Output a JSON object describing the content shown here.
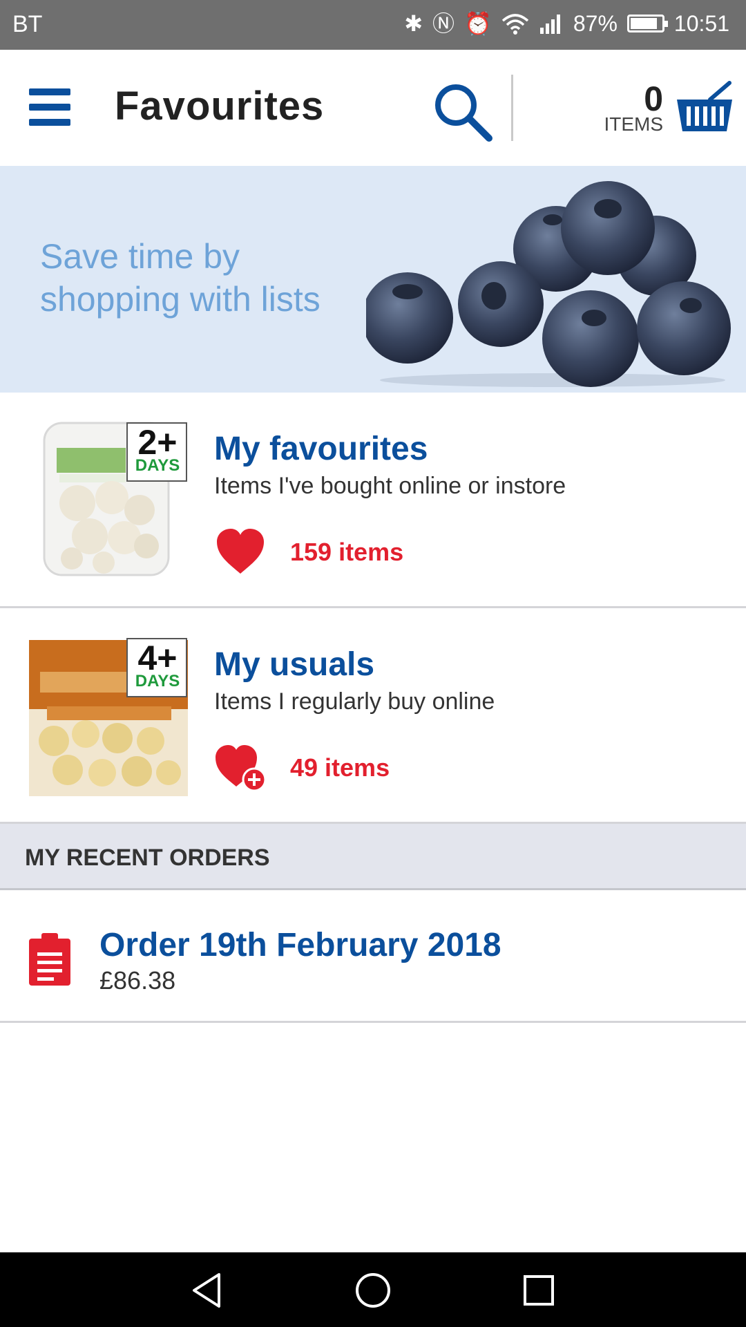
{
  "status_bar": {
    "carrier": "BT",
    "battery_percent": "87%",
    "battery_level": 0.87,
    "time": "10:51",
    "icons": [
      "bluetooth-icon",
      "nfc-icon",
      "alarm-icon",
      "wifi-icon",
      "signal-icon",
      "battery-icon"
    ]
  },
  "app_bar": {
    "title": "Favourites",
    "basket_count": "0",
    "basket_label": "ITEMS"
  },
  "banner": {
    "text": "Save time by shopping with lists"
  },
  "lists": [
    {
      "title": "My favourites",
      "subtitle": "Items I've bought online or instore",
      "count": "159 items",
      "badge_num": "2+",
      "badge_days": "DAYS",
      "icon": "heart-icon"
    },
    {
      "title": "My usuals",
      "subtitle": "Items I regularly buy online",
      "count": "49 items",
      "badge_num": "4+",
      "badge_days": "DAYS",
      "icon": "heart-plus-icon"
    }
  ],
  "recent_orders": {
    "header": "MY RECENT ORDERS",
    "orders": [
      {
        "title": "Order 19th February 2018",
        "total": "£86.38"
      }
    ]
  },
  "colors": {
    "brand_blue": "#0b4f9c",
    "accent_red": "#e2202e",
    "banner_bg": "#dde8f6",
    "banner_text": "#6ea3d8"
  }
}
